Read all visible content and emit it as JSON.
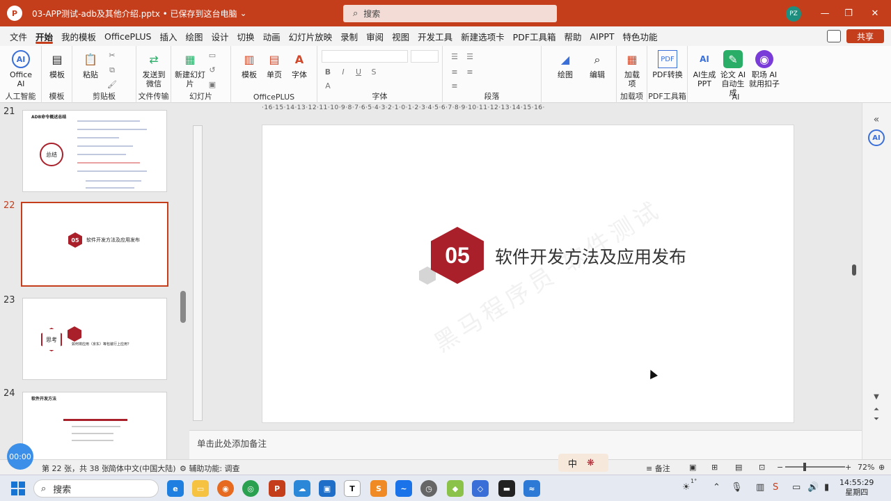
{
  "titlebar": {
    "doc_title": "03-APP测试-adb及其他介绍.pptx • 已保存到这台电脑",
    "search_placeholder": "搜索",
    "avatar_initials": "PZ",
    "accent": "#c43e1c"
  },
  "menu": {
    "tabs": [
      "文件",
      "开始",
      "我的模板",
      "OfficePLUS",
      "插入",
      "绘图",
      "设计",
      "切换",
      "动画",
      "幻灯片放映",
      "录制",
      "审阅",
      "视图",
      "开发工具",
      "新建选项卡",
      "PDF工具箱",
      "帮助",
      "AIPPT",
      "特色功能"
    ],
    "active_index": 1,
    "share_label": "共享"
  },
  "ribbon": {
    "office_ai": "Office AI",
    "group_ai": "人工智能",
    "template": "模板",
    "group_template": "模板",
    "paste": "粘贴",
    "group_clipboard": "剪贴板",
    "send_wechat": "发送到微信",
    "group_filetransfer": "文件传输",
    "new_slide": "新建幻灯片",
    "group_slides": "幻灯片",
    "template2": "模板",
    "single_page": "单页",
    "font_btn": "字体",
    "group_officeplus": "OfficePLUS",
    "group_font": "字体",
    "group_paragraph": "段落",
    "draw": "绘图",
    "edit": "编辑",
    "addin": "加载项",
    "group_addin": "加载项",
    "pdf_convert": "PDF转换",
    "group_pdf": "PDF工具箱",
    "ai_ppt": "AI生成PPT",
    "paper_ai": "论文 AI 自动生成",
    "job_ai": "职场 AI 就用扣子",
    "group_ai2": "AI"
  },
  "thumbnails": [
    {
      "num": "21",
      "title": "ADB命令概述总结",
      "badge": "总结"
    },
    {
      "num": "22",
      "badge": "05",
      "title": "软件开发方法及应用发布"
    },
    {
      "num": "23",
      "badge": "思考",
      "title": "如何将应用（京东）等包装行上应用？"
    },
    {
      "num": "24",
      "title": "软件开发方法"
    }
  ],
  "ruler": {
    "h_labels": "·16·15·14·13·12·11·10·9·8·7·6·5·4·3·2·1·0·1·2·3·4·5·6·7·8·9·10·11·12·13·14·15·16·"
  },
  "slide": {
    "number_badge": "05",
    "heading": "软件开发方法及应用发布",
    "watermark": "黑马程序员 软件测试"
  },
  "notes": {
    "placeholder": "单击此处添加备注"
  },
  "statusbar": {
    "timer": "00:00",
    "slide_info": "第 22 张，共 38 张",
    "language": "简体中文(中国大陆)",
    "accessibility": "辅助功能: 调查",
    "notes_btn": "备注",
    "zoom": "72%",
    "zoom_value": 0.72
  },
  "ime": {
    "mode": "中"
  },
  "taskbar": {
    "search_placeholder": "搜索",
    "time": "14:55:29",
    "weekday": "星期四",
    "temp": "1°"
  }
}
